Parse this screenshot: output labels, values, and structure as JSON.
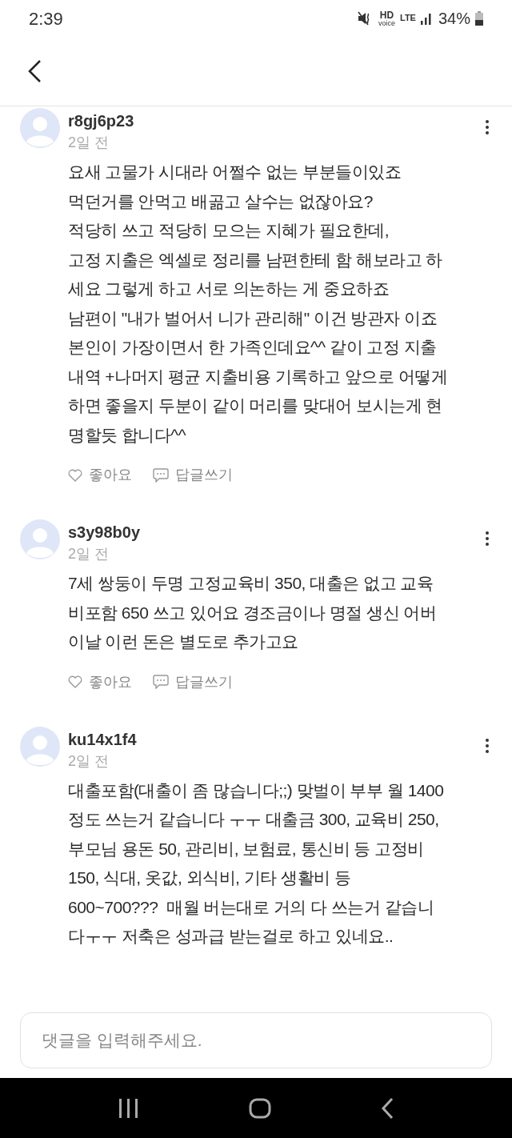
{
  "status_bar": {
    "time": "2:39",
    "hd": "HD",
    "voice": "voice",
    "network": "LTE",
    "battery": "34%"
  },
  "comments": [
    {
      "username": "r8gj6p23",
      "time": "2일 전",
      "text": "요새 고물가 시대라 어쩔수 없는 부분들이있죠\n먹던거를 안먹고 배곪고 살수는 없잖아요?\n적당히 쓰고 적당히 모으는 지혜가 필요한데,\n고정 지출은 엑셀로 정리를 남편한테 함 해보라고 하\n세요 그렇게 하고 서로 의논하는 게 중요하죠\n남편이 \"내가 벌어서 니가 관리해\" 이건 방관자 이죠\n본인이 가장이면서 한 가족인데요^^ 같이 고정 지출\n내역 +나머지 평균 지출비용 기록하고 앞으로 어떻게\n하면 좋을지 두분이 같이 머리를 맞대어 보시는게 현\n명할듯 합니다^^",
      "like": "좋아요",
      "reply": "답글쓰기"
    },
    {
      "username": "s3y98b0y",
      "time": "2일 전",
      "text": "7세 쌍둥이 두명 고정교육비 350, 대출은 없고 교육\n비포함 650 쓰고 있어요 경조금이나 명절 생신 어버\n이날 이런 돈은 별도로 추가고요",
      "like": "좋아요",
      "reply": "답글쓰기"
    },
    {
      "username": "ku14x1f4",
      "time": "2일 전",
      "text": "대출포함(대출이 좀 많습니다;;) 맞벌이 부부 월 1400\n정도 쓰는거 같습니다 ㅜㅜ 대출금 300, 교육비 250,\n부모님 용돈 50, 관리비, 보험료, 통신비 등 고정비\n150, 식대, 옷값, 외식비, 기타 생활비 등\n600~700???  매월 버는대로 거의 다 쓰는거 같습니\n다ㅜㅜ 저축은 성과급 받는걸로 하고 있네요.."
    }
  ],
  "comment_input": {
    "placeholder": "댓글을 입력해주세요."
  }
}
